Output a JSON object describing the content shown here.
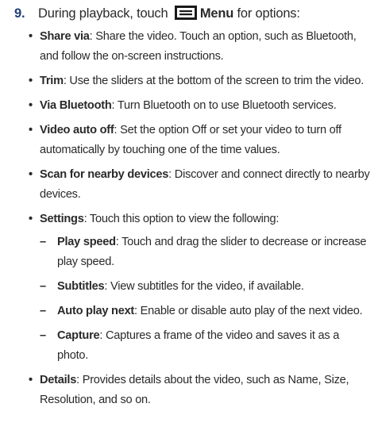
{
  "step": {
    "number": "9.",
    "text_before": "During playback, touch",
    "menu_icon": "menu-icon",
    "menu_label": "Menu",
    "text_after": "for options:"
  },
  "bullets": [
    {
      "term": "Share via",
      "desc": ": Share the video. Touch an option, such as Bluetooth, and follow the on-screen instructions."
    },
    {
      "term": "Trim",
      "desc": ": Use the sliders at the bottom of the screen to trim the video."
    },
    {
      "term": "Via Bluetooth",
      "desc": ": Turn Bluetooth on to use Bluetooth services."
    },
    {
      "term": "Video auto off",
      "desc": ": Set the option Off or set your video to turn off automatically by touching one of the time values."
    },
    {
      "term": "Scan for nearby devices",
      "desc": ": Discover and connect directly to nearby devices."
    },
    {
      "term": "Settings",
      "desc": ": Touch this option to view the following:"
    },
    {
      "term": "Details",
      "desc": ": Provides details about the video, such as Name, Size, Resolution, and so on."
    }
  ],
  "settings_sub": [
    {
      "term": "Play speed",
      "desc": ": Touch and drag the slider to decrease or increase play speed."
    },
    {
      "term": "Subtitles",
      "desc": ": View subtitles for the video, if available."
    },
    {
      "term": "Auto play next",
      "desc": ": Enable or disable auto play of the next video."
    },
    {
      "term": "Capture",
      "desc": ": Captures a frame of the video and saves it as a photo."
    }
  ],
  "glyphs": {
    "bullet": "•",
    "dash": "–"
  },
  "colors": {
    "text": "#2a2a2a",
    "step_number": "#1f3f7a",
    "icon": "#1a1a1a"
  }
}
